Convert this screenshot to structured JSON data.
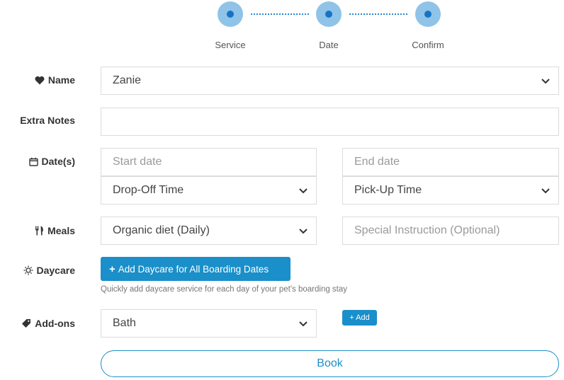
{
  "stepper": {
    "steps": [
      {
        "label": "Service"
      },
      {
        "label": "Date"
      },
      {
        "label": "Confirm"
      }
    ]
  },
  "form": {
    "name": {
      "label": "Name",
      "icon": "heart-icon",
      "value": "Zanie"
    },
    "extra_notes": {
      "label": "Extra Notes",
      "value": ""
    },
    "dates": {
      "label": "Date(s)",
      "icon": "calendar-icon",
      "start_placeholder": "Start date",
      "end_placeholder": "End date",
      "dropoff_value": "Drop-Off Time",
      "pickup_value": "Pick-Up Time"
    },
    "meals": {
      "label": "Meals",
      "icon": "utensils-icon",
      "value": "Organic diet (Daily)",
      "instruction_placeholder": "Special Instruction (Optional)"
    },
    "daycare": {
      "label": "Daycare",
      "icon": "sun-icon",
      "button_label": "Add Daycare for All Boarding Dates",
      "button_icon": "plus-icon",
      "hint": "Quickly add daycare service for each day of your pet's boarding stay"
    },
    "addons": {
      "label": "Add-ons",
      "icon": "tag-icon",
      "value": "Bath",
      "add_button": "+ Add"
    },
    "book_button": "Book"
  },
  "colors": {
    "accent": "#1a8fc9",
    "step_outer": "#8fc3e8",
    "step_inner": "#1673c4"
  }
}
